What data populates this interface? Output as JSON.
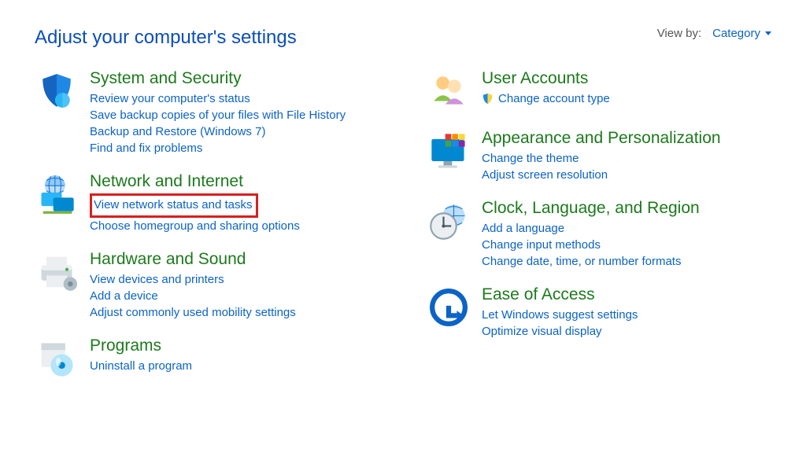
{
  "header": {
    "title": "Adjust your computer's settings",
    "viewby_label": "View by:",
    "viewby_value": "Category"
  },
  "left": [
    {
      "id": "system-security",
      "title": "System and Security",
      "links": [
        "Review your computer's status",
        "Save backup copies of your files with File History",
        "Backup and Restore (Windows 7)",
        "Find and fix problems"
      ]
    },
    {
      "id": "network-internet",
      "title": "Network and Internet",
      "links": [
        "View network status and tasks",
        "Choose homegroup and sharing options"
      ],
      "highlight": 0
    },
    {
      "id": "hardware-sound",
      "title": "Hardware and Sound",
      "links": [
        "View devices and printers",
        "Add a device",
        "Adjust commonly used mobility settings"
      ]
    },
    {
      "id": "programs",
      "title": "Programs",
      "links": [
        "Uninstall a program"
      ]
    }
  ],
  "right": [
    {
      "id": "user-accounts",
      "title": "User Accounts",
      "links": [
        "Change account type"
      ],
      "shield_on": 0
    },
    {
      "id": "appearance",
      "title": "Appearance and Personalization",
      "links": [
        "Change the theme",
        "Adjust screen resolution"
      ]
    },
    {
      "id": "clock-language",
      "title": "Clock, Language, and Region",
      "links": [
        "Add a language",
        "Change input methods",
        "Change date, time, or number formats"
      ]
    },
    {
      "id": "ease-of-access",
      "title": "Ease of Access",
      "links": [
        "Let Windows suggest settings",
        "Optimize visual display"
      ]
    }
  ]
}
